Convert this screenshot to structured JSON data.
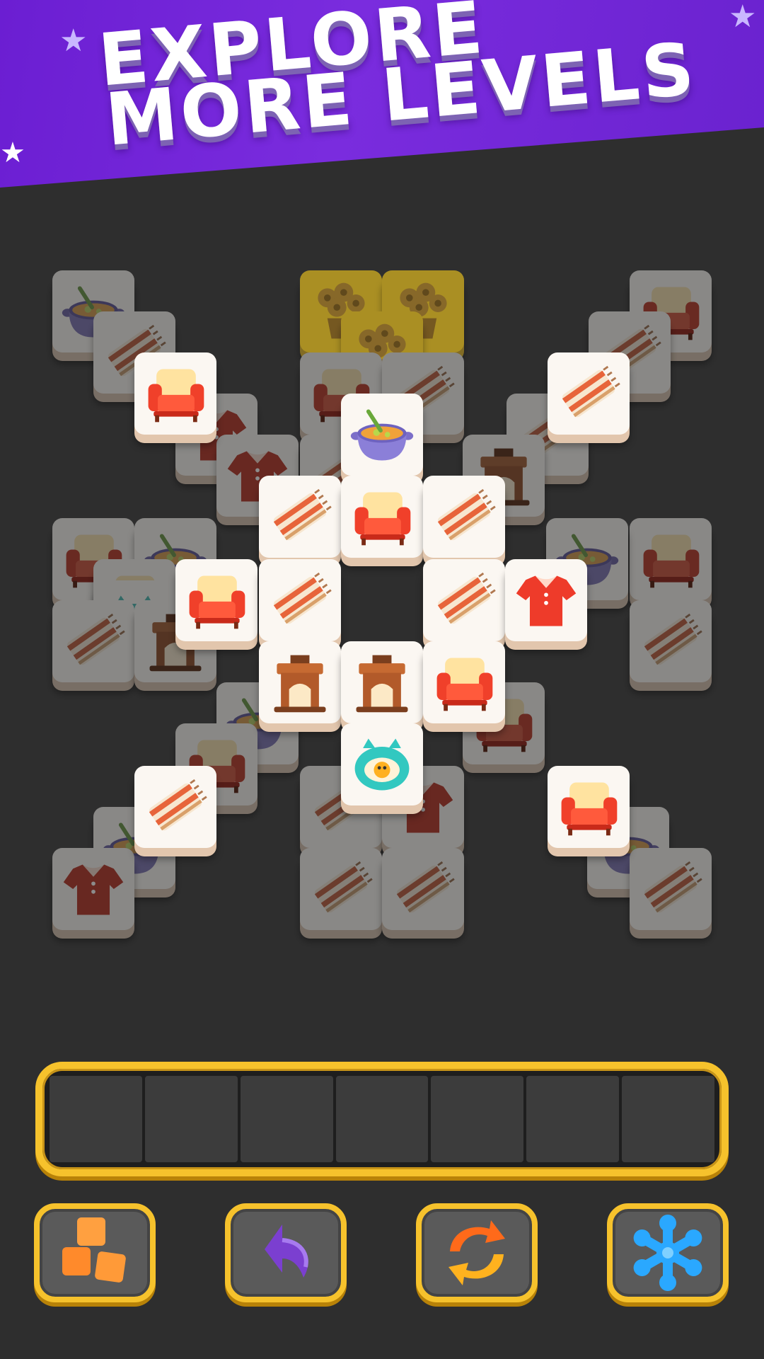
{
  "banner": {
    "line1": "EXPLORE",
    "line2": "MORE LEVELS",
    "background_color": "#6b1ed2",
    "text_color": "#ffffff"
  },
  "board": {
    "tiles": [
      {
        "item": "soup-pot",
        "state": "covered"
      },
      {
        "item": "rug",
        "state": "covered"
      },
      {
        "item": "armchair",
        "state": "open"
      },
      {
        "item": "shirt",
        "state": "covered"
      },
      {
        "item": "flowers",
        "state": "covered"
      },
      {
        "item": "flowers",
        "state": "covered"
      },
      {
        "item": "flowers",
        "state": "covered"
      },
      {
        "item": "armchair",
        "state": "covered"
      },
      {
        "item": "rug",
        "state": "covered"
      },
      {
        "item": "soup-pot",
        "state": "open"
      },
      {
        "item": "armchair",
        "state": "covered"
      },
      {
        "item": "rug",
        "state": "covered"
      },
      {
        "item": "rug",
        "state": "open"
      },
      {
        "item": "rug",
        "state": "covered"
      },
      {
        "item": "shirt",
        "state": "covered"
      },
      {
        "item": "rug",
        "state": "covered"
      },
      {
        "item": "rug",
        "state": "open"
      },
      {
        "item": "armchair",
        "state": "open"
      },
      {
        "item": "rug",
        "state": "open"
      },
      {
        "item": "fireplace",
        "state": "covered"
      },
      {
        "item": "armchair",
        "state": "covered"
      },
      {
        "item": "soup-pot",
        "state": "covered"
      },
      {
        "item": "armchair",
        "state": "covered"
      },
      {
        "item": "pet-bed",
        "state": "covered"
      },
      {
        "item": "rug",
        "state": "covered"
      },
      {
        "item": "fireplace",
        "state": "covered"
      },
      {
        "item": "armchair",
        "state": "covered"
      },
      {
        "item": "soup-pot",
        "state": "covered"
      },
      {
        "item": "rug",
        "state": "covered"
      },
      {
        "item": "armchair",
        "state": "open"
      },
      {
        "item": "rug",
        "state": "open"
      },
      {
        "item": "rug",
        "state": "open"
      },
      {
        "item": "shirt",
        "state": "open"
      },
      {
        "item": "fireplace",
        "state": "open"
      },
      {
        "item": "fireplace",
        "state": "open"
      },
      {
        "item": "armchair",
        "state": "open"
      },
      {
        "item": "soup-pot",
        "state": "covered"
      },
      {
        "item": "armchair",
        "state": "covered"
      },
      {
        "item": "pet-bed",
        "state": "open"
      },
      {
        "item": "armchair",
        "state": "covered"
      },
      {
        "item": "rug",
        "state": "open"
      },
      {
        "item": "rug",
        "state": "covered"
      },
      {
        "item": "shirt",
        "state": "covered"
      },
      {
        "item": "armchair",
        "state": "open"
      },
      {
        "item": "soup-pot",
        "state": "covered"
      },
      {
        "item": "soup-pot",
        "state": "covered"
      },
      {
        "item": "shirt",
        "state": "covered"
      },
      {
        "item": "rug",
        "state": "covered"
      },
      {
        "item": "rug",
        "state": "covered"
      },
      {
        "item": "rug",
        "state": "covered"
      }
    ]
  },
  "tray": {
    "slot_count": 7,
    "border_color": "#f6c22c",
    "slot_color": "#3c3c3c"
  },
  "boosters": [
    {
      "icon": "blocks-icon",
      "color": "#ff8a2b"
    },
    {
      "icon": "undo-arrow-icon",
      "color": "#7b3fd0"
    },
    {
      "icon": "shuffle-icon",
      "color": "#ff6a1a"
    },
    {
      "icon": "snowflake-icon",
      "color": "#2aa8ff"
    }
  ]
}
